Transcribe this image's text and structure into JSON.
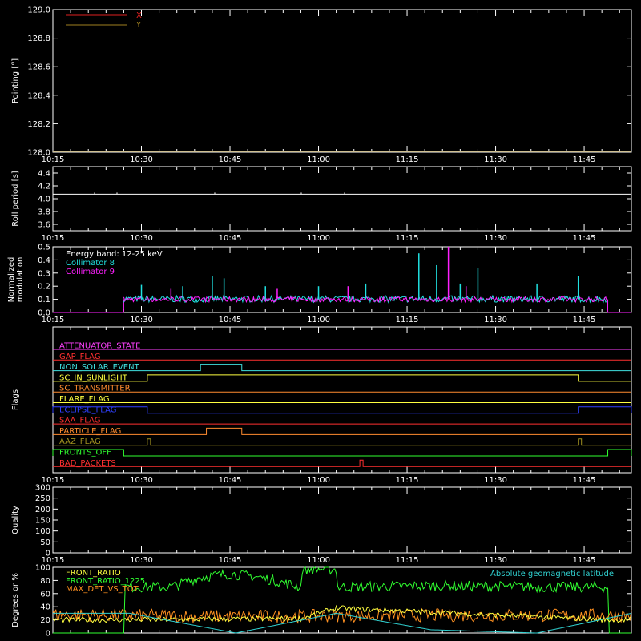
{
  "time_ticks": [
    "10:15",
    "10:30",
    "10:45",
    "11:00",
    "11:15",
    "11:30",
    "11:45"
  ],
  "colors": {
    "x_series": "#e02020",
    "y_series": "#a08020",
    "collimator8": "#20e0e0",
    "collimator9": "#ff20ff",
    "front_ratio": "#ffff40",
    "front_ratio_1225": "#30ff30",
    "max_det": "#ff9020",
    "geomag": "#30d0d0"
  },
  "chart_data": [
    {
      "type": "line",
      "ylabel": "Pointing [°]",
      "ylim": [
        128.0,
        129.0
      ],
      "yticks": [
        "128.0",
        "128.2",
        "128.4",
        "128.6",
        "128.8",
        "129.0"
      ],
      "legend": [
        "X",
        "Y"
      ],
      "series": [
        {
          "name": "X",
          "values": []
        },
        {
          "name": "Y",
          "values": []
        }
      ]
    },
    {
      "type": "line",
      "ylabel": "Roll period [s]",
      "ylim": [
        3.5,
        4.5
      ],
      "yticks": [
        "3.6",
        "3.8",
        "4.0",
        "4.2",
        "4.4"
      ],
      "series": [
        {
          "value": 4.07
        }
      ]
    },
    {
      "type": "bar",
      "ylabel": [
        "Normalized",
        "modulation"
      ],
      "ylim": [
        0.0,
        0.5
      ],
      "yticks": [
        "0.0",
        "0.1",
        "0.2",
        "0.3",
        "0.4",
        "0.5"
      ],
      "legend": [
        "Energy band: 12-25 keV",
        "Collimator 8",
        "Collimator 9"
      ],
      "active_range": [
        "10:27",
        "11:49"
      ],
      "baseline": 0.1,
      "spikes": [
        {
          "series": "Collimator 8",
          "time": "10:30",
          "value": 0.21
        },
        {
          "series": "Collimator 8",
          "time": "10:37",
          "value": 0.2
        },
        {
          "series": "Collimator 8",
          "time": "10:42",
          "value": 0.28
        },
        {
          "series": "Collimator 8",
          "time": "10:44",
          "value": 0.26
        },
        {
          "series": "Collimator 8",
          "time": "10:51",
          "value": 0.2
        },
        {
          "series": "Collimator 8",
          "time": "11:00",
          "value": 0.2
        },
        {
          "series": "Collimator 8",
          "time": "11:08",
          "value": 0.22
        },
        {
          "series": "Collimator 8",
          "time": "11:17",
          "value": 0.45
        },
        {
          "series": "Collimator 8",
          "time": "11:20",
          "value": 0.36
        },
        {
          "series": "Collimator 8",
          "time": "11:24",
          "value": 0.22
        },
        {
          "series": "Collimator 8",
          "time": "11:27",
          "value": 0.34
        },
        {
          "series": "Collimator 8",
          "time": "11:37",
          "value": 0.22
        },
        {
          "series": "Collimator 8",
          "time": "11:44",
          "value": 0.28
        },
        {
          "series": "Collimator 9",
          "time": "10:35",
          "value": 0.18
        },
        {
          "series": "Collimator 9",
          "time": "10:53",
          "value": 0.18
        },
        {
          "series": "Collimator 9",
          "time": "11:05",
          "value": 0.2
        },
        {
          "series": "Collimator 9",
          "time": "11:22",
          "value": 0.52
        },
        {
          "series": "Collimator 9",
          "time": "11:25",
          "value": 0.2
        }
      ]
    },
    {
      "type": "line",
      "ylabel": "Flags",
      "flags": [
        {
          "name": "ATTENUATOR_STATE",
          "color": "#ff40ff",
          "steps": []
        },
        {
          "name": "GAP_FLAG",
          "color": "#ff3030",
          "steps": []
        },
        {
          "name": "NON_SOLAR_EVENT",
          "color": "#40e0e0",
          "steps": [
            [
              "10:40",
              "10:47"
            ]
          ]
        },
        {
          "name": "SC_IN_SUNLIGHT",
          "color": "#ffff40",
          "steps": [
            [
              "10:31",
              "11:44"
            ]
          ]
        },
        {
          "name": "SC_TRANSMITTER",
          "color": "#ff8c30",
          "steps": []
        },
        {
          "name": "FLARE_FLAG",
          "color": "#ffff40",
          "steps": []
        },
        {
          "name": "ECLIPSE_FLAG",
          "color": "#3040ff",
          "steps": [
            [
              "10:15",
              "10:31"
            ],
            [
              "11:44",
              "11:53"
            ]
          ]
        },
        {
          "name": "SAA_FLAG",
          "color": "#ff3030",
          "steps": []
        },
        {
          "name": "PARTICLE_FLAG",
          "color": "#ff8c30",
          "steps": [
            [
              "10:41",
              "10:47"
            ]
          ]
        },
        {
          "name": "AAZ_FLAG",
          "color": "#a09020",
          "steps": [
            [
              "10:31",
              "10:31"
            ],
            [
              "11:44",
              "11:44"
            ]
          ]
        },
        {
          "name": "FRONTS_OFF",
          "color": "#30ff30",
          "steps": [
            [
              "10:15",
              "10:27"
            ],
            [
              "11:49",
              "11:53"
            ]
          ]
        },
        {
          "name": "BAD_PACKETS",
          "color": "#ff3030",
          "steps": [
            [
              "11:07",
              "11:07"
            ]
          ]
        }
      ]
    },
    {
      "type": "line",
      "ylabel": "Quality",
      "ylim": [
        0,
        300
      ],
      "yticks": [
        "0",
        "50",
        "100",
        "150",
        "200",
        "250",
        "300"
      ],
      "series": []
    },
    {
      "type": "line",
      "ylabel": "Degrees or %",
      "ylim": [
        0,
        100
      ],
      "yticks": [
        "0",
        "20",
        "40",
        "60",
        "80",
        "100"
      ],
      "legend": [
        "FRONT_RATIO",
        "FRONT_RATIO_1225",
        "MAX_DET_VS_TOT"
      ],
      "legend_right": "Absolute geomagnetic latitude",
      "series": [
        {
          "name": "FRONT_RATIO",
          "x": [
            "10:15",
            "10:27",
            "10:57",
            "11:03",
            "11:49",
            "11:53"
          ],
          "values": [
            20,
            20,
            22,
            38,
            20,
            20
          ]
        },
        {
          "name": "FRONT_RATIO_1225",
          "x": [
            "10:15",
            "10:27",
            "10:27",
            "10:35",
            "10:40",
            "10:45",
            "10:50",
            "10:57",
            "10:57",
            "11:03",
            "11:03",
            "11:20",
            "11:40",
            "11:49",
            "11:49",
            "11:53"
          ],
          "values": [
            0,
            0,
            70,
            70,
            85,
            90,
            85,
            70,
            97,
            97,
            70,
            72,
            70,
            70,
            0,
            0
          ]
        },
        {
          "name": "MAX_DET_VS_TOT",
          "x": [
            "10:15",
            "10:45",
            "11:15",
            "11:53"
          ],
          "values": [
            28,
            25,
            27,
            27
          ]
        },
        {
          "name": "Absolute geomagnetic latitude",
          "x": [
            "10:15",
            "10:28",
            "10:46",
            "11:03",
            "11:19",
            "11:37",
            "11:53"
          ],
          "values": [
            30,
            30,
            0,
            30,
            5,
            0,
            30
          ]
        }
      ]
    }
  ]
}
